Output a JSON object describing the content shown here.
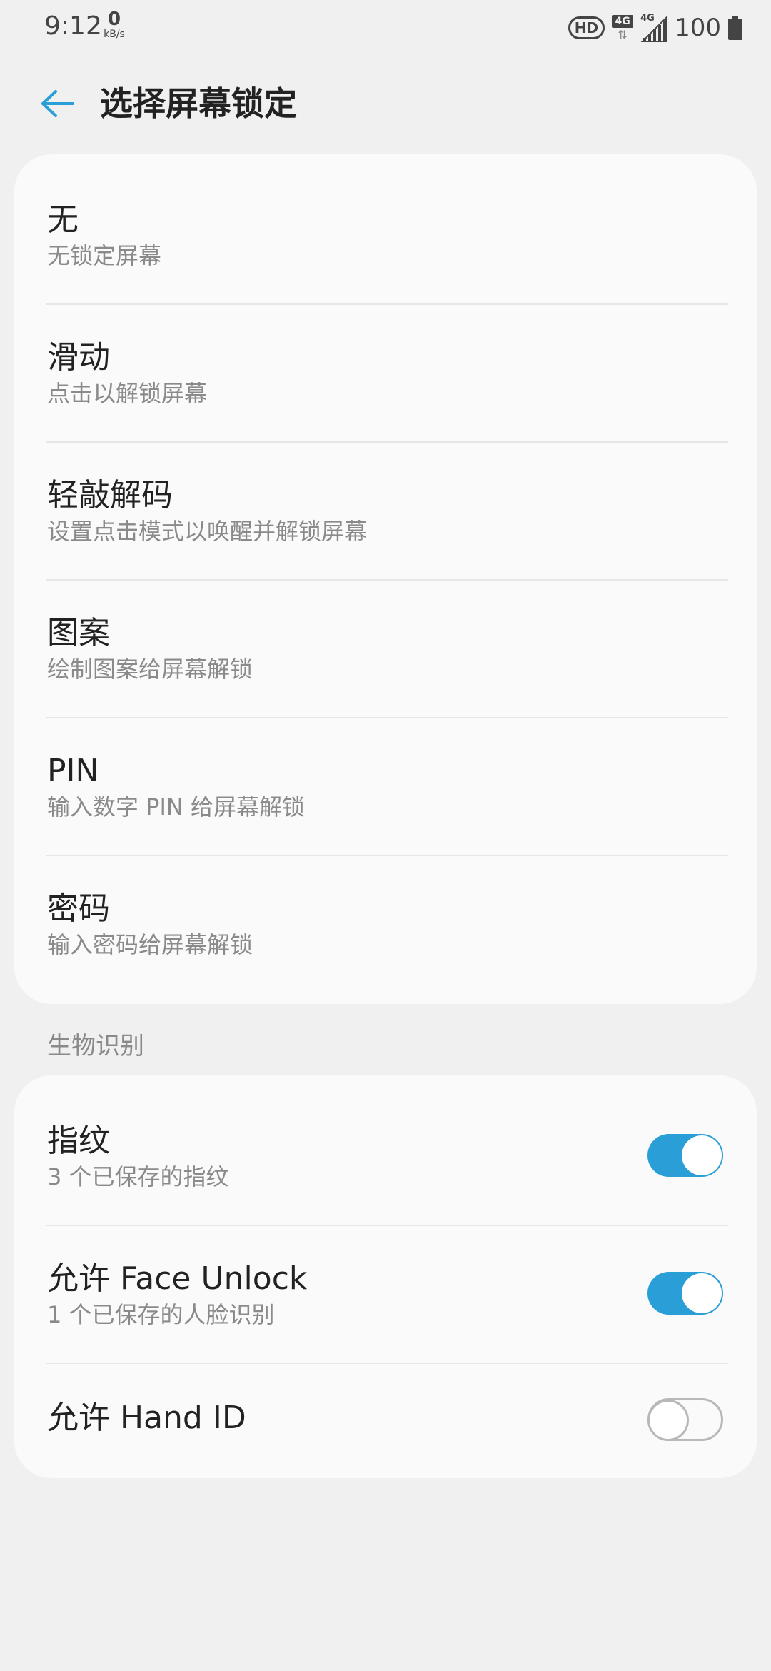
{
  "status_bar": {
    "time": "9:12",
    "net_speed_value": "0",
    "net_speed_unit": "kB/s",
    "hd_badge": "HD",
    "network_type": "4G",
    "signal_label": "4G",
    "battery_level": "100"
  },
  "header": {
    "title": "选择屏幕锁定"
  },
  "lock_options": [
    {
      "title": "无",
      "subtitle": "无锁定屏幕"
    },
    {
      "title": "滑动",
      "subtitle": "点击以解锁屏幕"
    },
    {
      "title": "轻敲解码",
      "subtitle": "设置点击模式以唤醒并解锁屏幕"
    },
    {
      "title": "图案",
      "subtitle": "绘制图案给屏幕解锁"
    },
    {
      "title": "PIN",
      "subtitle": "输入数字 PIN 给屏幕解锁"
    },
    {
      "title": "密码",
      "subtitle": "输入密码给屏幕解锁"
    }
  ],
  "biometrics": {
    "section_title": "生物识别",
    "items": [
      {
        "title": "指纹",
        "subtitle": "3 个已保存的指纹",
        "enabled": true
      },
      {
        "title": "允许 Face Unlock",
        "subtitle": "1 个已保存的人脸识别",
        "enabled": true
      },
      {
        "title": "允许 Hand ID",
        "subtitle": "",
        "enabled": false
      }
    ]
  },
  "colors": {
    "accent": "#2a9ed6",
    "background": "#f0f0f0",
    "card": "#fafafa"
  }
}
